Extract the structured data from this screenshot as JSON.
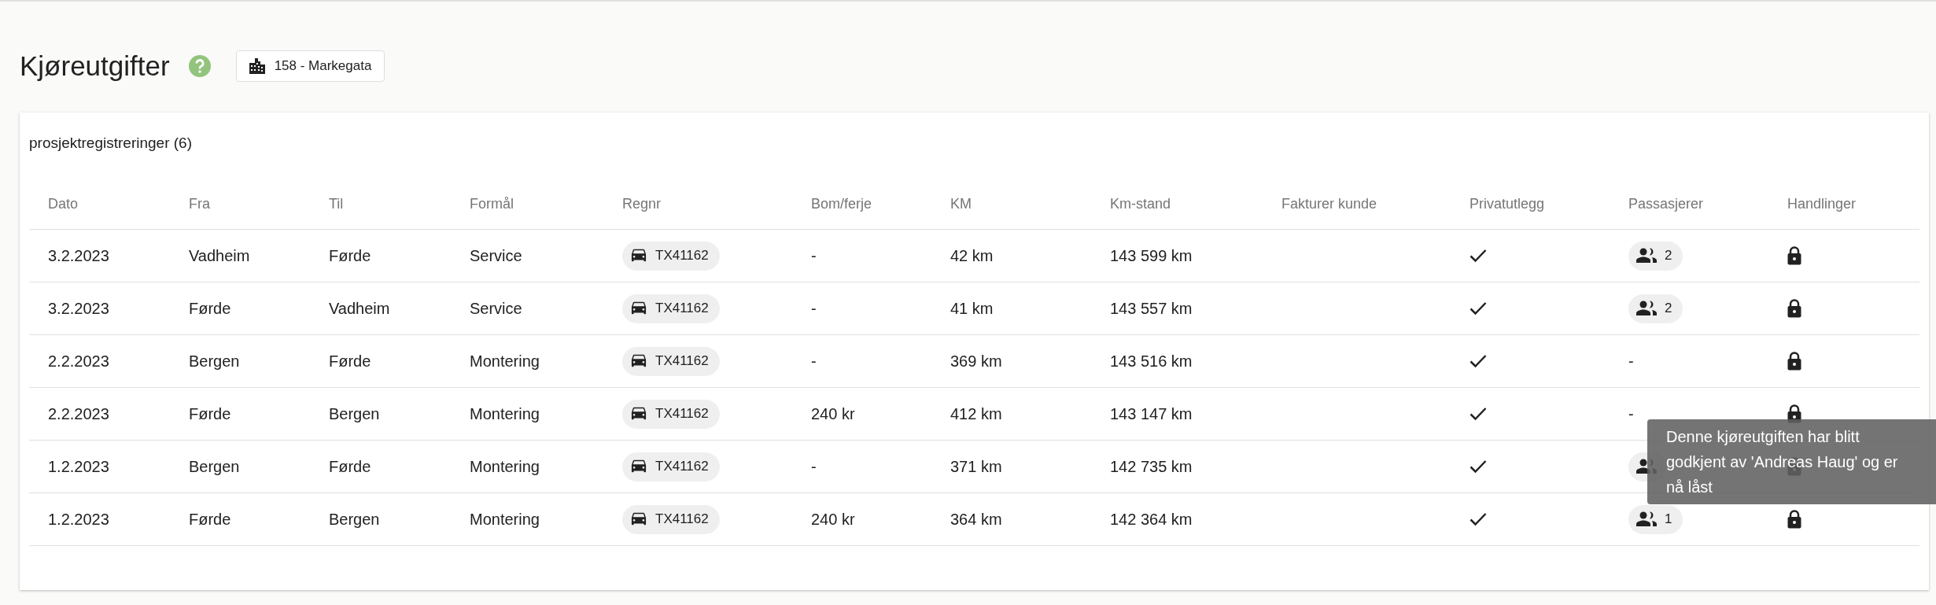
{
  "page": {
    "title": "Kjøreutgifter",
    "project": "158 - Markegata"
  },
  "card": {
    "title": "prosjektregistreringer (6)",
    "columns": [
      "Dato",
      "Fra",
      "Til",
      "Formål",
      "Regnr",
      "Bom/ferje",
      "KM",
      "Km-stand",
      "Fakturer kunde",
      "Privatutlegg",
      "Passasjerer",
      "Handlinger"
    ],
    "rows": [
      {
        "date": "3.2.2023",
        "from": "Vadheim",
        "to": "Førde",
        "purpose": "Service",
        "regnr": "TX41162",
        "toll": "-",
        "km": "42 km",
        "odometer": "143 599 km",
        "private": true,
        "passengers": {
          "kind": "chip",
          "count": "2"
        },
        "locked": true
      },
      {
        "date": "3.2.2023",
        "from": "Førde",
        "to": "Vadheim",
        "purpose": "Service",
        "regnr": "TX41162",
        "toll": "-",
        "km": "41 km",
        "odometer": "143 557 km",
        "private": true,
        "passengers": {
          "kind": "chip",
          "count": "2"
        },
        "locked": true
      },
      {
        "date": "2.2.2023",
        "from": "Bergen",
        "to": "Førde",
        "purpose": "Montering",
        "regnr": "TX41162",
        "toll": "-",
        "km": "369 km",
        "odometer": "143 516 km",
        "private": true,
        "passengers": {
          "kind": "none",
          "text": "-"
        },
        "locked": true
      },
      {
        "date": "2.2.2023",
        "from": "Førde",
        "to": "Bergen",
        "purpose": "Montering",
        "regnr": "TX41162",
        "toll": "240 kr",
        "km": "412 km",
        "odometer": "143 147 km",
        "private": true,
        "passengers": {
          "kind": "none",
          "text": "-"
        },
        "locked": true
      },
      {
        "date": "1.2.2023",
        "from": "Bergen",
        "to": "Førde",
        "purpose": "Montering",
        "regnr": "TX41162",
        "toll": "-",
        "km": "371 km",
        "odometer": "142 735 km",
        "private": true,
        "passengers": {
          "kind": "chip"
        },
        "locked": true
      },
      {
        "date": "1.2.2023",
        "from": "Førde",
        "to": "Bergen",
        "purpose": "Montering",
        "regnr": "TX41162",
        "toll": "240 kr",
        "km": "364 km",
        "odometer": "142 364 km",
        "private": true,
        "passengers": {
          "kind": "chip",
          "count": "1"
        },
        "locked": true
      }
    ]
  },
  "tooltip": {
    "text": "Denne kjøreutgiften har blitt godkjent av 'Andreas Haug' og er nå låst"
  }
}
